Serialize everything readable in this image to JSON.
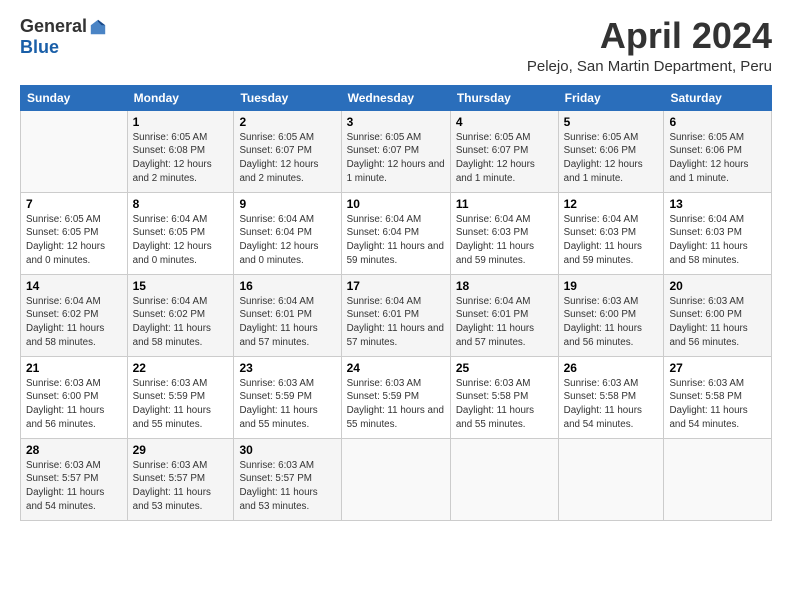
{
  "logo": {
    "general": "General",
    "blue": "Blue"
  },
  "title": "April 2024",
  "subtitle": "Pelejo, San Martin Department, Peru",
  "days_of_week": [
    "Sunday",
    "Monday",
    "Tuesday",
    "Wednesday",
    "Thursday",
    "Friday",
    "Saturday"
  ],
  "weeks": [
    [
      {
        "day": "",
        "sunrise": "",
        "sunset": "",
        "daylight": ""
      },
      {
        "day": "1",
        "sunrise": "Sunrise: 6:05 AM",
        "sunset": "Sunset: 6:08 PM",
        "daylight": "Daylight: 12 hours and 2 minutes."
      },
      {
        "day": "2",
        "sunrise": "Sunrise: 6:05 AM",
        "sunset": "Sunset: 6:07 PM",
        "daylight": "Daylight: 12 hours and 2 minutes."
      },
      {
        "day": "3",
        "sunrise": "Sunrise: 6:05 AM",
        "sunset": "Sunset: 6:07 PM",
        "daylight": "Daylight: 12 hours and 1 minute."
      },
      {
        "day": "4",
        "sunrise": "Sunrise: 6:05 AM",
        "sunset": "Sunset: 6:07 PM",
        "daylight": "Daylight: 12 hours and 1 minute."
      },
      {
        "day": "5",
        "sunrise": "Sunrise: 6:05 AM",
        "sunset": "Sunset: 6:06 PM",
        "daylight": "Daylight: 12 hours and 1 minute."
      },
      {
        "day": "6",
        "sunrise": "Sunrise: 6:05 AM",
        "sunset": "Sunset: 6:06 PM",
        "daylight": "Daylight: 12 hours and 1 minute."
      }
    ],
    [
      {
        "day": "7",
        "sunrise": "Sunrise: 6:05 AM",
        "sunset": "Sunset: 6:05 PM",
        "daylight": "Daylight: 12 hours and 0 minutes."
      },
      {
        "day": "8",
        "sunrise": "Sunrise: 6:04 AM",
        "sunset": "Sunset: 6:05 PM",
        "daylight": "Daylight: 12 hours and 0 minutes."
      },
      {
        "day": "9",
        "sunrise": "Sunrise: 6:04 AM",
        "sunset": "Sunset: 6:04 PM",
        "daylight": "Daylight: 12 hours and 0 minutes."
      },
      {
        "day": "10",
        "sunrise": "Sunrise: 6:04 AM",
        "sunset": "Sunset: 6:04 PM",
        "daylight": "Daylight: 11 hours and 59 minutes."
      },
      {
        "day": "11",
        "sunrise": "Sunrise: 6:04 AM",
        "sunset": "Sunset: 6:03 PM",
        "daylight": "Daylight: 11 hours and 59 minutes."
      },
      {
        "day": "12",
        "sunrise": "Sunrise: 6:04 AM",
        "sunset": "Sunset: 6:03 PM",
        "daylight": "Daylight: 11 hours and 59 minutes."
      },
      {
        "day": "13",
        "sunrise": "Sunrise: 6:04 AM",
        "sunset": "Sunset: 6:03 PM",
        "daylight": "Daylight: 11 hours and 58 minutes."
      }
    ],
    [
      {
        "day": "14",
        "sunrise": "Sunrise: 6:04 AM",
        "sunset": "Sunset: 6:02 PM",
        "daylight": "Daylight: 11 hours and 58 minutes."
      },
      {
        "day": "15",
        "sunrise": "Sunrise: 6:04 AM",
        "sunset": "Sunset: 6:02 PM",
        "daylight": "Daylight: 11 hours and 58 minutes."
      },
      {
        "day": "16",
        "sunrise": "Sunrise: 6:04 AM",
        "sunset": "Sunset: 6:01 PM",
        "daylight": "Daylight: 11 hours and 57 minutes."
      },
      {
        "day": "17",
        "sunrise": "Sunrise: 6:04 AM",
        "sunset": "Sunset: 6:01 PM",
        "daylight": "Daylight: 11 hours and 57 minutes."
      },
      {
        "day": "18",
        "sunrise": "Sunrise: 6:04 AM",
        "sunset": "Sunset: 6:01 PM",
        "daylight": "Daylight: 11 hours and 57 minutes."
      },
      {
        "day": "19",
        "sunrise": "Sunrise: 6:03 AM",
        "sunset": "Sunset: 6:00 PM",
        "daylight": "Daylight: 11 hours and 56 minutes."
      },
      {
        "day": "20",
        "sunrise": "Sunrise: 6:03 AM",
        "sunset": "Sunset: 6:00 PM",
        "daylight": "Daylight: 11 hours and 56 minutes."
      }
    ],
    [
      {
        "day": "21",
        "sunrise": "Sunrise: 6:03 AM",
        "sunset": "Sunset: 6:00 PM",
        "daylight": "Daylight: 11 hours and 56 minutes."
      },
      {
        "day": "22",
        "sunrise": "Sunrise: 6:03 AM",
        "sunset": "Sunset: 5:59 PM",
        "daylight": "Daylight: 11 hours and 55 minutes."
      },
      {
        "day": "23",
        "sunrise": "Sunrise: 6:03 AM",
        "sunset": "Sunset: 5:59 PM",
        "daylight": "Daylight: 11 hours and 55 minutes."
      },
      {
        "day": "24",
        "sunrise": "Sunrise: 6:03 AM",
        "sunset": "Sunset: 5:59 PM",
        "daylight": "Daylight: 11 hours and 55 minutes."
      },
      {
        "day": "25",
        "sunrise": "Sunrise: 6:03 AM",
        "sunset": "Sunset: 5:58 PM",
        "daylight": "Daylight: 11 hours and 55 minutes."
      },
      {
        "day": "26",
        "sunrise": "Sunrise: 6:03 AM",
        "sunset": "Sunset: 5:58 PM",
        "daylight": "Daylight: 11 hours and 54 minutes."
      },
      {
        "day": "27",
        "sunrise": "Sunrise: 6:03 AM",
        "sunset": "Sunset: 5:58 PM",
        "daylight": "Daylight: 11 hours and 54 minutes."
      }
    ],
    [
      {
        "day": "28",
        "sunrise": "Sunrise: 6:03 AM",
        "sunset": "Sunset: 5:57 PM",
        "daylight": "Daylight: 11 hours and 54 minutes."
      },
      {
        "day": "29",
        "sunrise": "Sunrise: 6:03 AM",
        "sunset": "Sunset: 5:57 PM",
        "daylight": "Daylight: 11 hours and 53 minutes."
      },
      {
        "day": "30",
        "sunrise": "Sunrise: 6:03 AM",
        "sunset": "Sunset: 5:57 PM",
        "daylight": "Daylight: 11 hours and 53 minutes."
      },
      {
        "day": "",
        "sunrise": "",
        "sunset": "",
        "daylight": ""
      },
      {
        "day": "",
        "sunrise": "",
        "sunset": "",
        "daylight": ""
      },
      {
        "day": "",
        "sunrise": "",
        "sunset": "",
        "daylight": ""
      },
      {
        "day": "",
        "sunrise": "",
        "sunset": "",
        "daylight": ""
      }
    ]
  ]
}
